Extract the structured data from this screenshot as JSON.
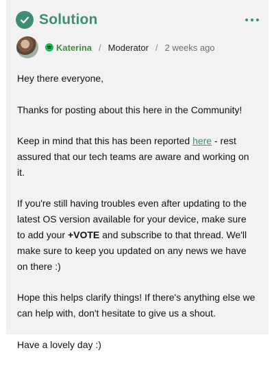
{
  "header": {
    "title": "Solution",
    "check_icon": "check-circle-icon",
    "more_icon": "more-horizontal-icon",
    "accent": "#3e8e72"
  },
  "author": {
    "name": "Katerina",
    "role": "Moderator",
    "separator": "/",
    "time": "2 weeks ago",
    "badge_icon": "spotify-icon",
    "badge_color": "#1db954"
  },
  "post": {
    "p1": "Hey there everyone,",
    "p2": "Thanks for posting about this here in the Community!",
    "p3_before": "Keep in mind that this has been reported ",
    "p3_link": "here",
    "p3_after": " - rest assured that our tech teams are aware and working on it.",
    "p4_before": "If you're still having troubles even after updating to the latest OS version available for your device, make sure to add your ",
    "p4_bold": "+VOTE",
    "p4_after": " and subscribe to that thread. We'll make sure to keep you updated on any news we have on there :)",
    "p5": "Hope this helps clarify things! If there's anything else we can help with, don't hesitate to give us a shout.",
    "p6": "Have a lovely day :)"
  }
}
